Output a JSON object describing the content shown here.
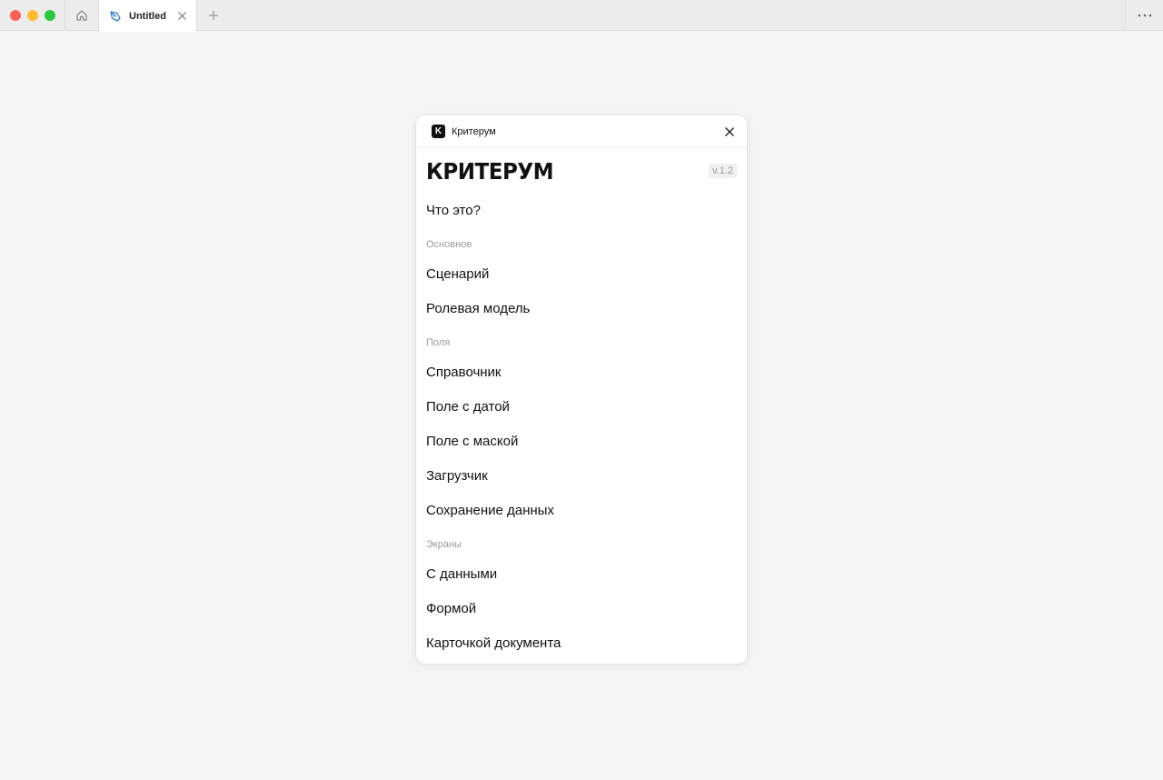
{
  "browser": {
    "tab_title": "Untitled"
  },
  "panel": {
    "header_logo_letter": "K",
    "header_title": "Критерум",
    "brand": "КРИТЕРУМ",
    "version": "v.1.2",
    "intro_item": "Что это?",
    "sections": [
      {
        "title": "Основное",
        "items": [
          "Сценарий",
          "Ролевая модель"
        ]
      },
      {
        "title": "Поля",
        "items": [
          "Справочник",
          "Поле с датой",
          "Поле с маской",
          "Загрузчик",
          "Сохранение данных"
        ]
      },
      {
        "title": "Экраны",
        "items": [
          "С данными",
          "Формой",
          "Карточкой документа"
        ]
      }
    ]
  },
  "colors": {
    "accent_tab_icon": "#2f7fd8",
    "traffic_red": "#fe5f57",
    "traffic_yellow": "#febc2e",
    "traffic_green": "#28c840"
  }
}
